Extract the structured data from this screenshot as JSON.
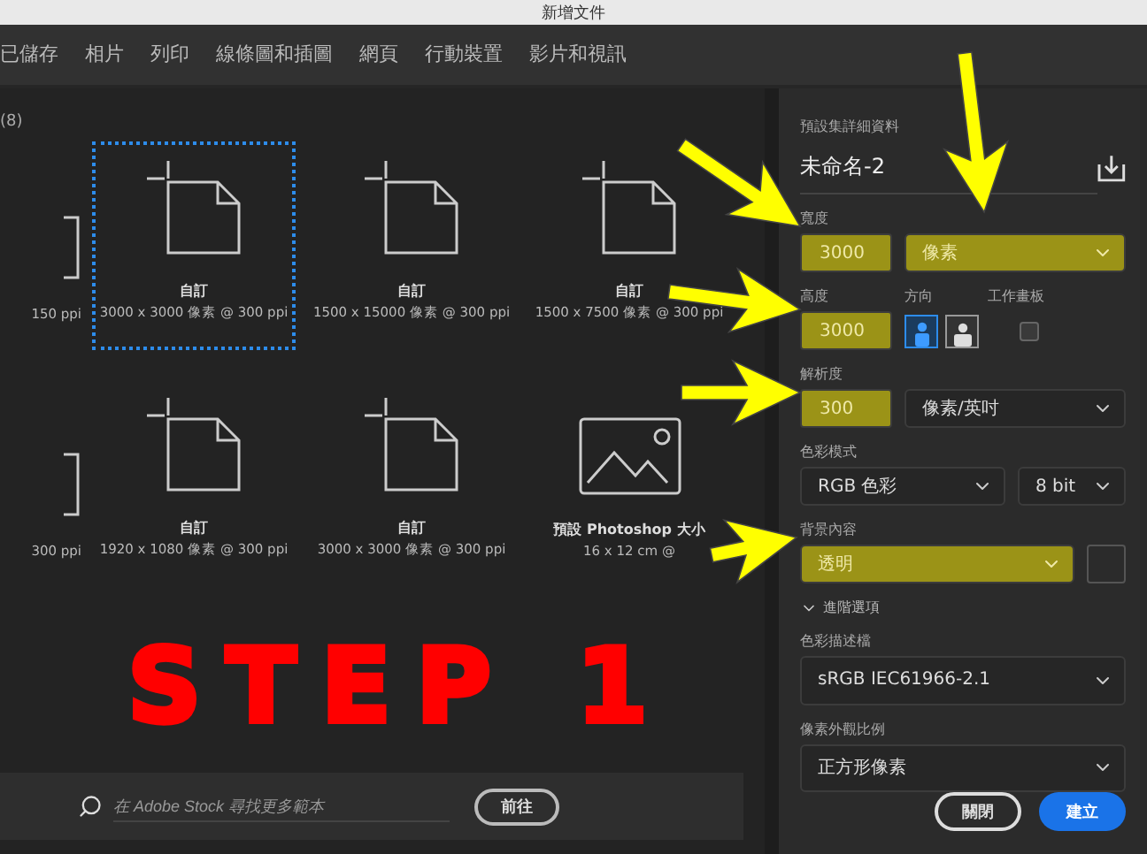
{
  "window": {
    "title": "新增文件"
  },
  "tabs": [
    {
      "label": "已儲存",
      "selected": false
    },
    {
      "label": "相片",
      "selected": false
    },
    {
      "label": "列印",
      "selected": false
    },
    {
      "label": "線條圖和插圖",
      "selected": false
    },
    {
      "label": "網頁",
      "selected": false
    },
    {
      "label": "行動裝置",
      "selected": false
    },
    {
      "label": "影片和視訊",
      "selected": false
    }
  ],
  "presets_count": "(8)",
  "presets": [
    {
      "kind": "document",
      "cut": true,
      "size": "150 ppi",
      "selected": false
    },
    {
      "kind": "document",
      "cut": false,
      "name": "自訂",
      "size": "3000 x 3000 像素 @ 300 ppi",
      "selected": true
    },
    {
      "kind": "document",
      "cut": false,
      "name": "自訂",
      "size": "1500 x 15000 像素 @ 300 ppi",
      "selected": false
    },
    {
      "kind": "document",
      "cut": false,
      "name": "自訂",
      "size": "1500 x 7500 像素 @ 300 ppi",
      "selected": false
    },
    {
      "kind": "document",
      "cut": true,
      "size": "300 ppi",
      "selected": false
    },
    {
      "kind": "document",
      "cut": false,
      "name": "自訂",
      "size": "1920 x 1080 像素 @ 300 ppi",
      "selected": false
    },
    {
      "kind": "document",
      "cut": false,
      "name": "自訂",
      "size": "3000 x 3000 像素 @ 300 ppi",
      "selected": false
    },
    {
      "kind": "photo",
      "cut": false,
      "name": "預設 Photoshop 大小",
      "size": "16 x 12 cm @",
      "selected": false
    }
  ],
  "annotation": "STEP 1",
  "stock_search": {
    "placeholder": "在 Adobe Stock 尋找更多範本",
    "button": "前往"
  },
  "details": {
    "heading": "預設集詳細資料",
    "name": "未命名-2",
    "width": {
      "label": "寬度",
      "value": "3000",
      "highlighted": true,
      "unit": "像素",
      "unit_highlighted": true
    },
    "height": {
      "label": "高度",
      "value": "3000",
      "highlighted": true
    },
    "orientation": {
      "label": "方向",
      "options": [
        {
          "kind": "portrait",
          "selected": true
        },
        {
          "kind": "landscape",
          "selected": false
        }
      ]
    },
    "artboard": {
      "label": "工作畫板",
      "checked": false
    },
    "resolution": {
      "label": "解析度",
      "value": "300",
      "highlighted": true,
      "unit": "像素/英吋",
      "unit_highlighted": false
    },
    "color_mode": {
      "label": "色彩模式",
      "value": "RGB 色彩",
      "depth": "8 bit"
    },
    "background": {
      "label": "背景內容",
      "value": "透明",
      "highlighted": true
    },
    "advanced": {
      "label": "進階選項",
      "expanded": true
    },
    "color_profile": {
      "label": "色彩描述檔",
      "value": "sRGB IEC61966-2.1"
    },
    "pixel_aspect": {
      "label": "像素外觀比例",
      "value": "正方形像素"
    }
  },
  "buttons": [
    {
      "label": "關閉",
      "kind": "secondary"
    },
    {
      "label": "建立",
      "kind": "primary"
    }
  ]
}
